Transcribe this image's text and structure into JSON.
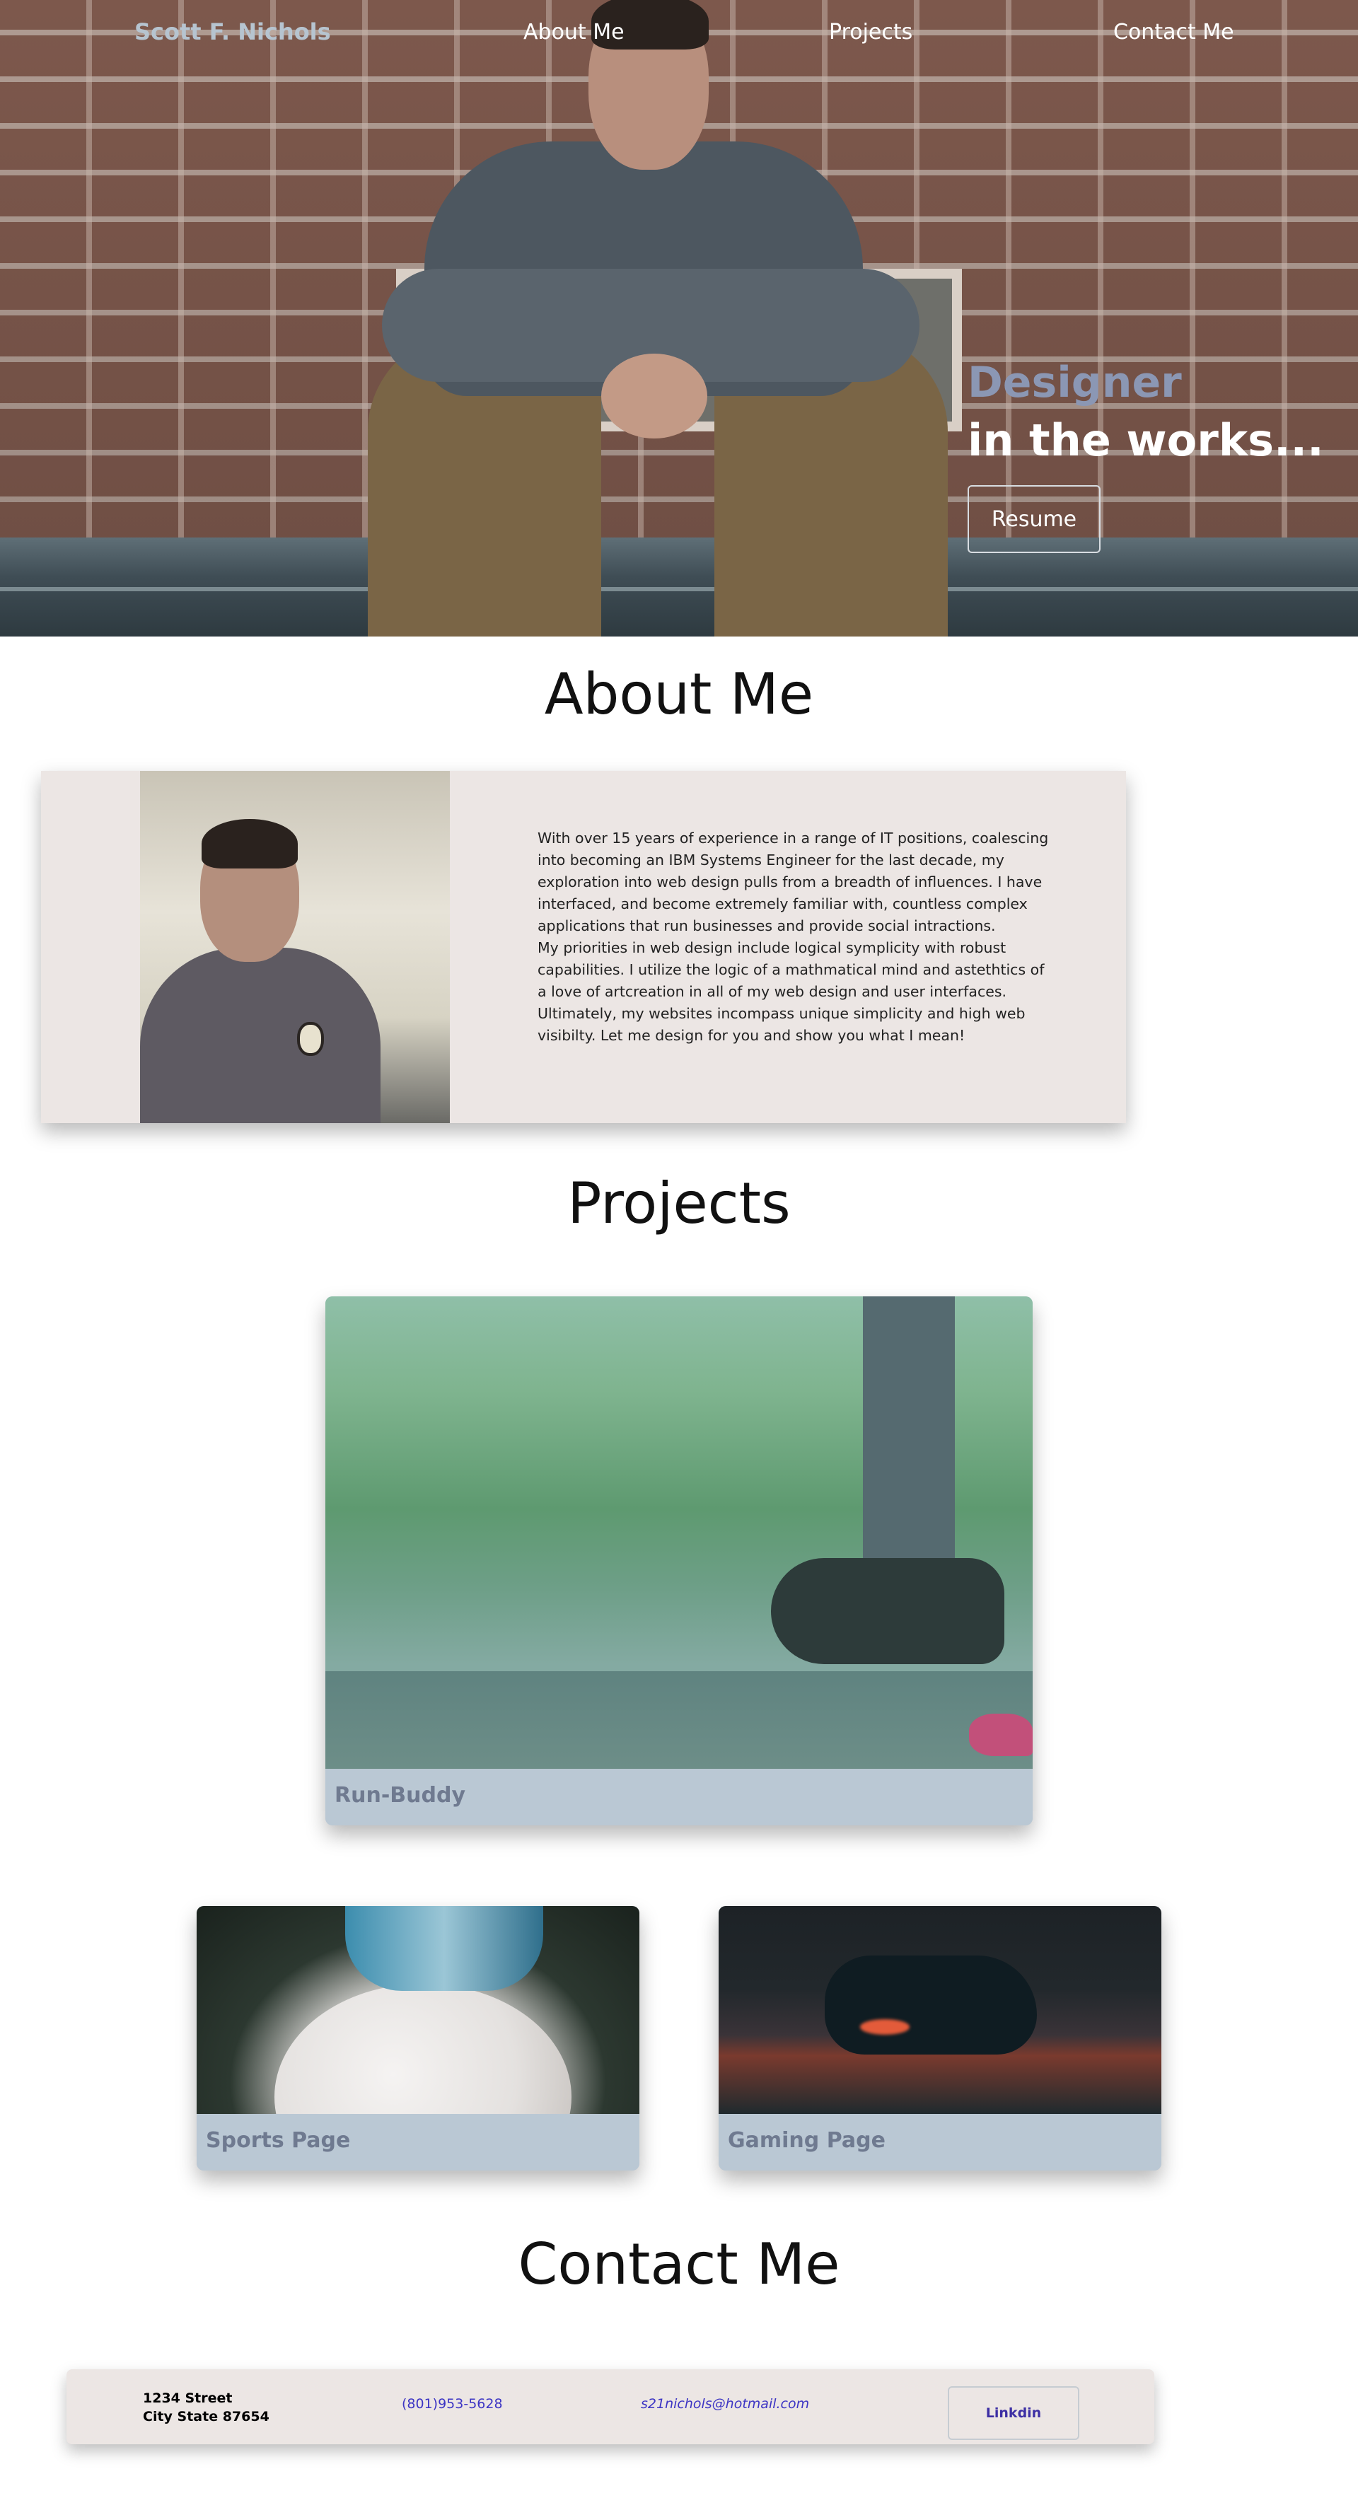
{
  "nav": {
    "brand": "Scott F. Nichols",
    "about": "About Me",
    "projects": "Projects",
    "contact": "Contact Me"
  },
  "hero": {
    "line1": "Designer",
    "line2": "in the works...",
    "resume_label": "Resume"
  },
  "sections": {
    "about_title": "About Me",
    "projects_title": "Projects",
    "contact_title": "Contact Me"
  },
  "about": {
    "paragraph1": "With over 15 years of experience in a range of IT positions, coalescing into becoming an IBM Systems Engineer for the last decade, my exploration into web design pulls from a breadth of influences. I have interfaced, and become extremely familiar with, countless complex applications that run businesses and provide social intractions.",
    "paragraph2": "My priorities in web design include logical symplicity with robust capabilities. I utilize the logic of a mathmatical mind and astethtics of a love of artcreation in all of my web design and user interfaces. Ultimately, my websites incompass unique simplicity and high web visibilty. Let me design for you and show you what I mean!"
  },
  "projects": [
    {
      "label": "Run-Buddy"
    },
    {
      "label": "Sports Page"
    },
    {
      "label": "Gaming Page"
    }
  ],
  "contact": {
    "address_line1": "1234 Street",
    "address_line2": "City State 87654",
    "phone": "(801)953-5628",
    "email": "s21nichols@hotmail.com",
    "linkedin_label": "Linkdin"
  },
  "colors": {
    "brand_text": "#b6c4d0",
    "hero_accent": "#8b97b4",
    "card_background": "#ece6e4",
    "project_label_bg": "#bac8d4",
    "project_label_text": "#6f7a90",
    "link_color": "#3d35c4"
  }
}
